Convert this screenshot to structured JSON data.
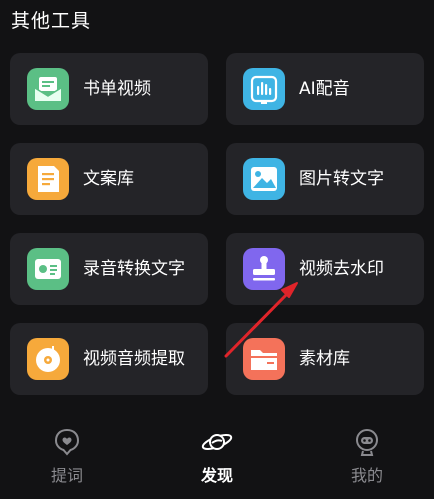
{
  "section": {
    "title": "其他工具"
  },
  "tools": [
    {
      "label": "书单视频",
      "icon": "book-video-icon",
      "color": "#5bbf85"
    },
    {
      "label": "AI配音",
      "icon": "ai-voice-icon",
      "color": "#3fb4e4"
    },
    {
      "label": "文案库",
      "icon": "document-icon",
      "color": "#f6a93b"
    },
    {
      "label": "图片转文字",
      "icon": "image-icon",
      "color": "#3fb4e4"
    },
    {
      "label": "录音转换文字",
      "icon": "recorder-icon",
      "color": "#5bbf85"
    },
    {
      "label": "视频去水印",
      "icon": "stamp-icon",
      "color": "#8067ee"
    },
    {
      "label": "视频音频提取",
      "icon": "disc-icon",
      "color": "#f6a93b"
    },
    {
      "label": "素材库",
      "icon": "folder-icon",
      "color": "#f4725a"
    }
  ],
  "tabbar": {
    "tabs": [
      {
        "label": "提词",
        "icon": "heart-chat-icon",
        "active": false
      },
      {
        "label": "发现",
        "icon": "planet-icon",
        "active": true
      },
      {
        "label": "我的",
        "icon": "robot-face-icon",
        "active": false
      }
    ]
  },
  "colors": {
    "background": "#121214",
    "tile": "#242428",
    "annotation_arrow": "#e0242a"
  }
}
